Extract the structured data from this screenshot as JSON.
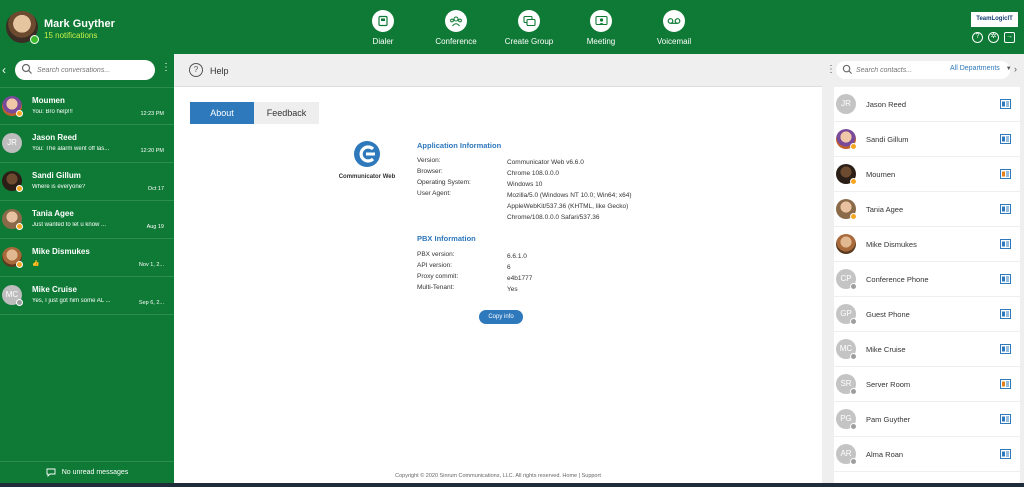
{
  "user": {
    "name": "Mark Guyther",
    "notifications": "15 notifications",
    "status_color": "#3dbb2c"
  },
  "nav": [
    {
      "label": "Dialer",
      "icon": "dialer-icon"
    },
    {
      "label": "Conference",
      "icon": "conference-icon"
    },
    {
      "label": "Create Group",
      "icon": "create-group-icon"
    },
    {
      "label": "Meeting",
      "icon": "meeting-icon"
    },
    {
      "label": "Voicemail",
      "icon": "voicemail-icon"
    }
  ],
  "brand": {
    "logo_text": "TeamLogicIT"
  },
  "colors": {
    "brand_green": "#0e7a35",
    "accent_blue": "#2e78bc",
    "away": "#f5a623",
    "offline": "#9e9e9e"
  },
  "left": {
    "search_placeholder": "Search conversations...",
    "footer": "No unread messages",
    "conversations": [
      {
        "name": "Moumen",
        "preview": "You: Bro help!!!",
        "time": "12:23 PM",
        "initials": "",
        "status": "away"
      },
      {
        "name": "Jason Reed",
        "preview": "You: The alarm went off las...",
        "time": "12:20 PM",
        "initials": "JR",
        "status": "none"
      },
      {
        "name": "Sandi Gillum",
        "preview": "Where is everyone?",
        "time": "Oct 17",
        "initials": "",
        "status": "away"
      },
      {
        "name": "Tania Agee",
        "preview": "Just wanted to let u know ...",
        "time": "Aug 19",
        "initials": "",
        "status": "away"
      },
      {
        "name": "Mike Dismukes",
        "preview": "👍",
        "time": "Nov 1, 2...",
        "initials": "",
        "status": "away"
      },
      {
        "name": "Mike Cruise",
        "preview": "Yes, I just got him some AL ...",
        "time": "Sep 6, 2...",
        "initials": "MC",
        "status": "offline"
      }
    ]
  },
  "center": {
    "title": "Help",
    "tabs": [
      "About",
      "Feedback"
    ],
    "app_name": "Communicator Web",
    "app_info_title": "Application Information",
    "app_info": [
      {
        "key": "Version:",
        "value": "Communicator Web v6.6.0"
      },
      {
        "key": "Browser:",
        "value": "Chrome 108.0.0.0"
      },
      {
        "key": "Operating System:",
        "value": "Windows 10"
      },
      {
        "key": "User Agent:",
        "value": "Mozilla/5.0 (Windows NT 10.0; Win64; x64) AppleWebKit/537.36 (KHTML, like Gecko) Chrome/108.0.0.0 Safari/537.36"
      }
    ],
    "pbx_info_title": "PBX Information",
    "pbx_info": [
      {
        "key": "PBX version:",
        "value": "6.6.1.0"
      },
      {
        "key": "API version:",
        "value": "6"
      },
      {
        "key": "Proxy commit:",
        "value": "e4b1777"
      },
      {
        "key": "Multi-Tenant:",
        "value": "Yes"
      }
    ],
    "copy_button": "Copy info",
    "copyright": "Copyright © 2020 Sinrum Communications, LLC. All rights reserved. Home | Support"
  },
  "right": {
    "search_placeholder": "Search contacts...",
    "department": "All Departments",
    "contacts": [
      {
        "name": "Jason Reed",
        "initials": "JR",
        "status": "none",
        "card": "blue"
      },
      {
        "name": "Sandi Gillum",
        "initials": "",
        "status": "away",
        "card": "blue"
      },
      {
        "name": "Moumen",
        "initials": "",
        "status": "away",
        "card": "orange"
      },
      {
        "name": "Tania Agee",
        "initials": "",
        "status": "away",
        "card": "blue"
      },
      {
        "name": "Mike Dismukes",
        "initials": "",
        "status": "none",
        "card": "blue"
      },
      {
        "name": "Conference Phone",
        "initials": "CP",
        "status": "offline",
        "card": "blue"
      },
      {
        "name": "Guest Phone",
        "initials": "GP",
        "status": "offline",
        "card": "blue"
      },
      {
        "name": "Mike Cruise",
        "initials": "MC",
        "status": "offline",
        "card": "blue"
      },
      {
        "name": "Server Room",
        "initials": "SR",
        "status": "offline",
        "card": "orange"
      },
      {
        "name": "Pam Guyther",
        "initials": "PG",
        "status": "offline",
        "card": "blue"
      },
      {
        "name": "Alma Roan",
        "initials": "AR",
        "status": "offline",
        "card": "blue"
      }
    ]
  }
}
